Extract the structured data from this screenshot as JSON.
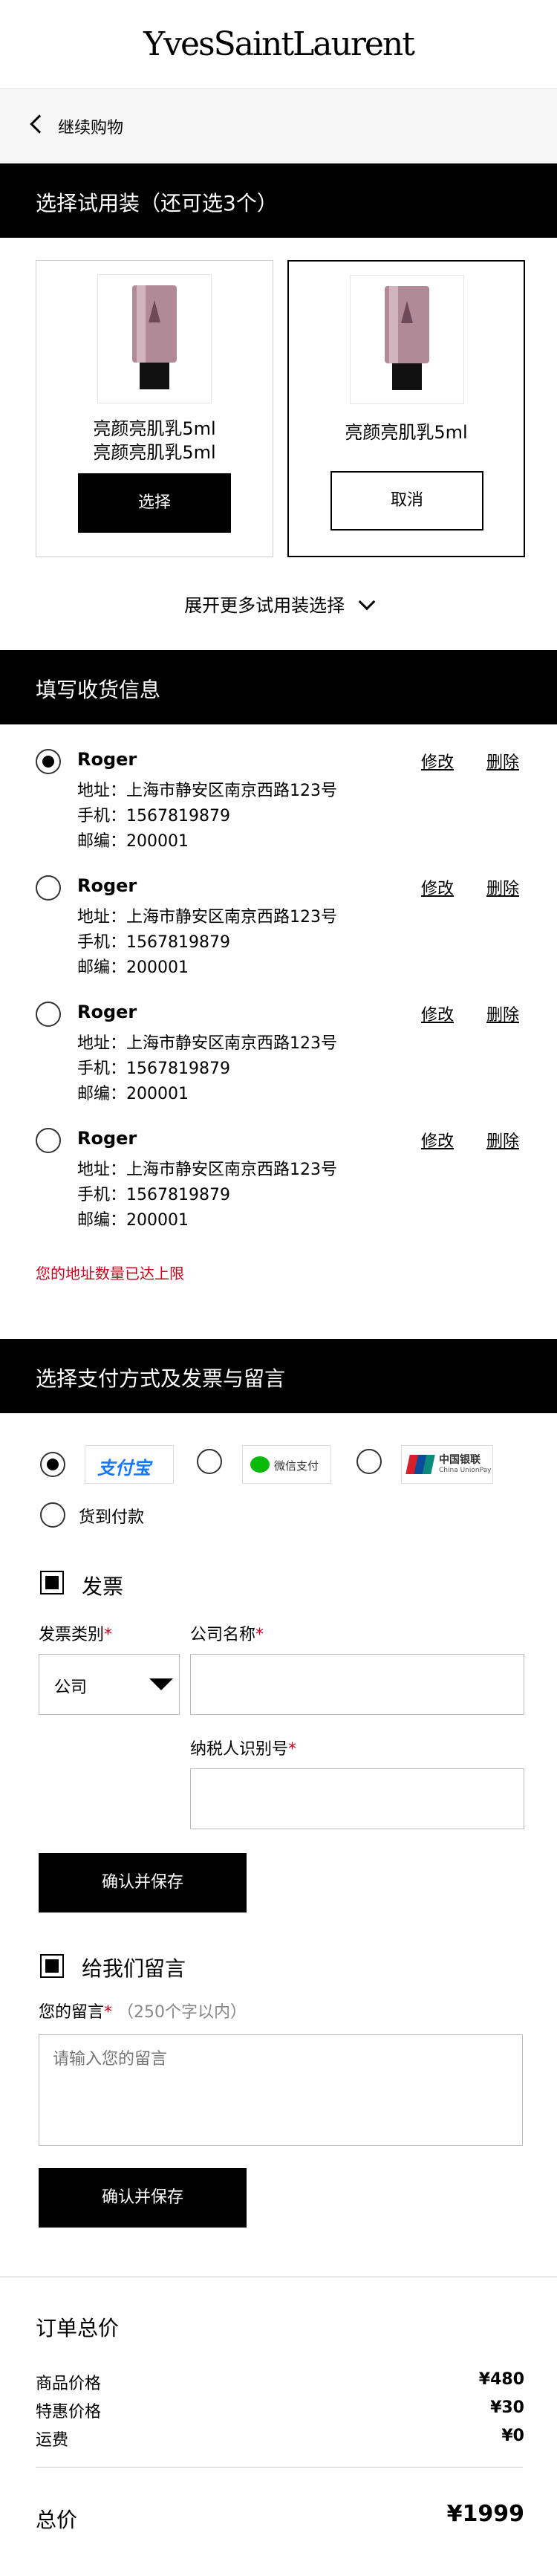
{
  "header": {
    "brand": "YvesSaintLaurent"
  },
  "back": {
    "label": "继续购物"
  },
  "samples": {
    "title": "选择试用装（还可选3个）",
    "cards": [
      {
        "name_lines": [
          "亮颜亮肌乳5ml",
          "亮颜亮肌乳5ml"
        ],
        "button": "选择",
        "selected": false
      },
      {
        "name_lines": [
          "亮颜亮肌乳5ml"
        ],
        "button": "取消",
        "selected": true
      }
    ],
    "expand_label": "展开更多试用装选择"
  },
  "shipping": {
    "title": "填写收货信息",
    "edit_label": "修改",
    "delete_label": "删除",
    "addresses": [
      {
        "name": "Roger",
        "address": "地址：上海市静安区南京西路123号",
        "phone": "手机：1567819879",
        "zip": "邮编：200001",
        "selected": true
      },
      {
        "name": "Roger",
        "address": "地址：上海市静安区南京西路123号",
        "phone": "手机：1567819879",
        "zip": "邮编：200001",
        "selected": false
      },
      {
        "name": "Roger",
        "address": "地址：上海市静安区南京西路123号",
        "phone": "手机：1567819879",
        "zip": "邮编：200001",
        "selected": false
      },
      {
        "name": "Roger",
        "address": "地址：上海市静安区南京西路123号",
        "phone": "手机：1567819879",
        "zip": "邮编：200001",
        "selected": false
      }
    ],
    "limit_warning": "您的地址数量已达上限"
  },
  "payment": {
    "title": "选择支付方式及发票与留言",
    "options": [
      {
        "label": "支付宝",
        "selected": true
      },
      {
        "label": "微信支付",
        "selected": false
      },
      {
        "label": "中国银联",
        "sublabel": "China UnionPay",
        "selected": false
      }
    ],
    "cod_label": "货到付款"
  },
  "invoice": {
    "title": "发票",
    "type_label": "发票类别",
    "type_value": "公司",
    "company_label": "公司名称",
    "tax_label": "纳税人识别号",
    "required_mark": "*",
    "save_label": "确认并保存"
  },
  "message": {
    "title": "给我们留言",
    "label": "您的留言",
    "required_mark": "*",
    "hint": "（250个字以内）",
    "placeholder": "请输入您的留言",
    "save_label": "确认并保存"
  },
  "summary": {
    "title": "订单总价",
    "rows": [
      {
        "label": "商品价格",
        "value": "¥480"
      },
      {
        "label": "特惠价格",
        "value": "¥30"
      },
      {
        "label": "运费",
        "value": "¥0"
      }
    ],
    "total_label": "总价",
    "total_value": "¥1999"
  },
  "colors": {
    "accent": "#000000",
    "warning": "#d0021b",
    "wechat": "#09bb07",
    "alipay": "#1677ff"
  }
}
